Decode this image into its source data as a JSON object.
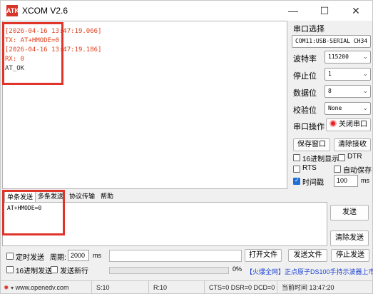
{
  "window": {
    "title": "XCOM V2.6",
    "icon_text": "ATK",
    "controls": {
      "minimize": "—",
      "maximize": "☐",
      "close": "✕"
    }
  },
  "receive": {
    "lines": [
      "[2026-04-16 13:47:19.066]",
      "TX: AT+HMODE=0",
      "[2026-04-16 13:47:19.186]",
      "RX: 0",
      "AT_OK"
    ]
  },
  "serial_panel": {
    "section_title": "串口选择",
    "port": "COM11:USB-SERIAL CH34",
    "baud_label": "波特率",
    "baud_value": "115200",
    "stopbits_label": "停止位",
    "stopbits_value": "1",
    "databits_label": "数据位",
    "databits_value": "8",
    "parity_label": "校验位",
    "parity_value": "None",
    "operation_label": "串口操作",
    "close_port_button": "关闭串口",
    "save_window_button": "保存窗口",
    "clear_receive_button": "清除接收",
    "hex_display_label": "16进制显示",
    "dtr_label": "DTR",
    "rts_label": "RTS",
    "auto_save_label": "自动保存",
    "timestamp_label": "时间戳",
    "timestamp_value": "100",
    "timestamp_unit": "ms",
    "timestamp_checked": true
  },
  "tabs": [
    "单条发送",
    "多条发送",
    "协议传输",
    "帮助"
  ],
  "send": {
    "text": "AT+HMODE=0",
    "send_button": "发送",
    "clear_send_button": "清除发送"
  },
  "options": {
    "timed_send_label": "定时发送",
    "period_label": "周期:",
    "period_value": "2000",
    "period_unit": "ms",
    "hex_send_label": "16进制发送",
    "send_newline_label": "发送新行",
    "open_file_button": "打开文件",
    "send_file_button": "发送文件",
    "stop_send_button": "停止发送",
    "progress_percent": "0%",
    "progress_value": 0,
    "promo_link": "【火爆全网】正点原子DS100手持示波器上市"
  },
  "statusbar": {
    "website": "www.openedv.com",
    "sent": "S:10",
    "received": "R:10",
    "signals": "CTS=0 DSR=0 DCD=0",
    "time": "当前时间 13:47:20"
  },
  "colors": {
    "highlight": "#e0342b",
    "recv_text": "#e0401f",
    "checkbox_accent": "#1f6fd6",
    "link": "#1a3fd1"
  }
}
